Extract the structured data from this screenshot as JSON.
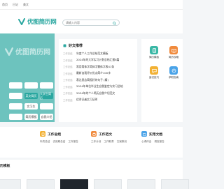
{
  "topbar": {
    "links": [
      "首页",
      "日记",
      "美文"
    ]
  },
  "header": {
    "logo_text": "优图简历网",
    "search_placeholder": "请输入内容"
  },
  "banner": {
    "logo_text": "优图简历网",
    "pills": [
      "",
      "",
      "",
      "",
      "英文简历",
      "大学生简历",
      "",
      "实习生",
      "",
      "",
      "简历模板",
      "自我介绍"
    ],
    "active_pills": [
      4,
      5
    ]
  },
  "hot": {
    "title": "好文推荐",
    "items": [
      {
        "tag": "工作总结",
        "text": "年度个人工作总结范文模板"
      },
      {
        "tag": "工作总结",
        "text": "2024年的大学实习计划总结汇报8篇"
      },
      {
        "tag": "工作总结",
        "text": "常用简体字简体字繁体字表41条"
      },
      {
        "tag": "工作总结",
        "text": "最新自我评价优点简介100字"
      },
      {
        "tag": "工作总结",
        "text": "表达思念简报好的句子 (精)"
      },
      {
        "tag": "工作总结",
        "text": "2024年单位毕业生自我鉴定与实习总结"
      },
      {
        "tag": "工作总结",
        "text": "2024年的个人简历自我介绍范文"
      },
      {
        "tag": "工作总结",
        "text": "优秀记者实习证明"
      }
    ]
  },
  "quick": {
    "items": [
      {
        "label": "简历模板",
        "icon": "document-icon",
        "color": "#39b7a5"
      },
      {
        "label": "简历攻略",
        "icon": "book-icon",
        "color": "#f08a3c"
      },
      {
        "label": "面试技巧",
        "icon": "chat-icon",
        "color": "#f2b134"
      },
      {
        "label": "求职指南",
        "icon": "target-icon",
        "color": "#4aa3e8"
      }
    ]
  },
  "categories": [
    {
      "title": "",
      "links": [
        "",
        "",
        "",
        "",
        "",
        ""
      ],
      "color": "#2aa7a0"
    },
    {
      "title": "工作总结",
      "links": [
        "年终总结",
        "试用期总结",
        "工作报告",
        "",
        "",
        ""
      ],
      "color": "#f2b134"
    },
    {
      "title": "工作范文",
      "links": [
        "工作计划",
        "工作职责",
        "文案策划",
        "",
        "",
        ""
      ],
      "color": "#f08a3c"
    },
    {
      "title": "实用文档",
      "links": [
        "心得体会",
        "调查报告",
        "",
        "",
        "",
        ""
      ],
      "color": "#4aa3e8"
    }
  ],
  "section": {
    "title": "历模板"
  },
  "colors": {
    "brand": "#2aa7a0",
    "banner": "#6dc3be"
  }
}
